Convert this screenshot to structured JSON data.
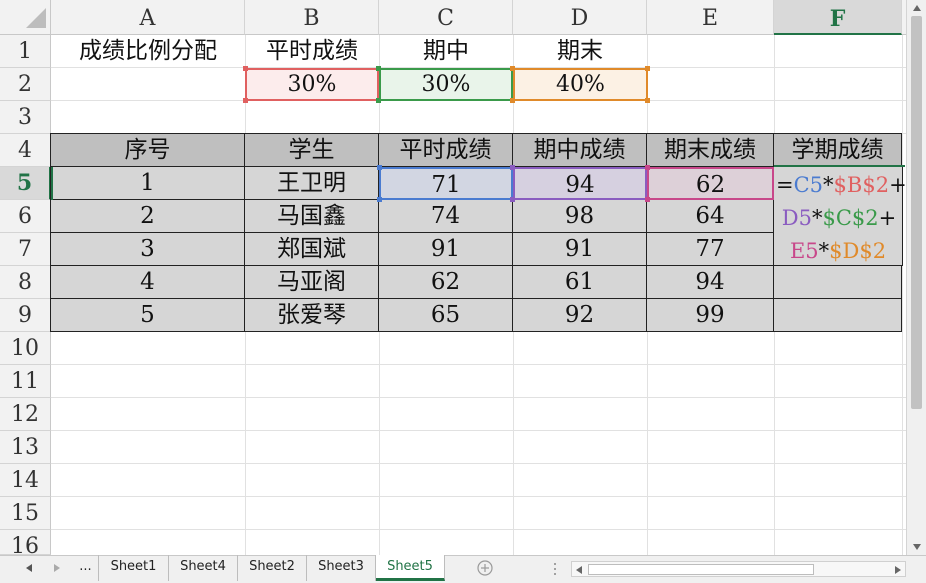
{
  "columns": [
    "A",
    "B",
    "C",
    "D",
    "E",
    "F"
  ],
  "rows": [
    "1",
    "2",
    "3",
    "4",
    "5",
    "6",
    "7",
    "8",
    "9",
    "10",
    "11",
    "12",
    "13",
    "14",
    "15",
    "16"
  ],
  "ratio": {
    "label": "成绩比例分配",
    "headers": [
      "平时成绩",
      "期中",
      "期末"
    ],
    "values": [
      "30%",
      "30%",
      "40%"
    ]
  },
  "table": {
    "headers": [
      "序号",
      "学生",
      "平时成绩",
      "期中成绩",
      "期末成绩",
      "学期成绩"
    ],
    "rows": [
      [
        "1",
        "王卫明",
        "71",
        "94",
        "62"
      ],
      [
        "2",
        "马国鑫",
        "74",
        "98",
        "64"
      ],
      [
        "3",
        "郑国斌",
        "91",
        "91",
        "77"
      ],
      [
        "4",
        "马亚阁",
        "62",
        "61",
        "94"
      ],
      [
        "5",
        "张爱琴",
        "65",
        "92",
        "99"
      ]
    ]
  },
  "formula": {
    "eq": "=",
    "c5": "C5",
    "star1": "*",
    "b2": "$B$2",
    "plus1": "+",
    "d5": "D5",
    "star2": "*",
    "c2": "$C$2",
    "plus2": "+",
    "e5": "E5",
    "star3": "*",
    "d2": "$D$2"
  },
  "sheet_tabs": [
    "Sheet1",
    "Sheet4",
    "Sheet2",
    "Sheet3",
    "Sheet5"
  ],
  "active_tab": "Sheet5",
  "tab_ellipsis": "...",
  "colors": {
    "ref_c5": "#4a7bd0",
    "ref_b2": "#e06060",
    "ref_d5": "#8a5cc0",
    "ref_c2": "#3a9a4a",
    "ref_e5": "#c8478a",
    "ref_d2": "#e08a2a",
    "accent": "#217346"
  },
  "icons": {
    "add_sheet": "plus-circle-icon",
    "prev": "triangle-left-icon",
    "next": "triangle-right-icon"
  }
}
